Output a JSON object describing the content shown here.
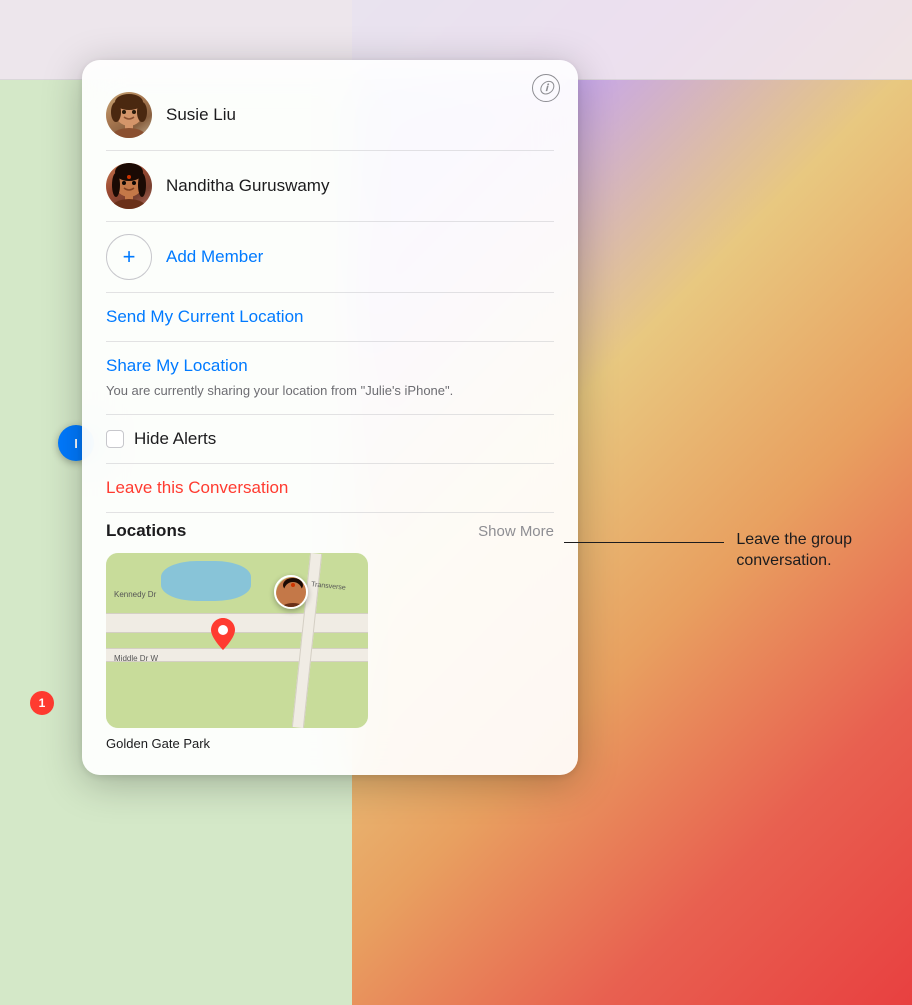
{
  "background": {
    "map_color": "#d4e8c8",
    "gradient_color_start": "#a8c8e8",
    "gradient_color_end": "#e84040"
  },
  "panel": {
    "info_icon": "ⓘ",
    "members": [
      {
        "name": "Susie Liu",
        "avatar_emoji": "👩",
        "avatar_type": "susie"
      },
      {
        "name": "Nanditha Guruswamy",
        "avatar_emoji": "👩",
        "avatar_type": "nanditha"
      }
    ],
    "add_member_label": "Add Member",
    "add_member_icon": "+",
    "actions": {
      "send_location": "Send My Current Location",
      "share_location": "Share My Location",
      "sharing_description": "You are currently sharing your location from \"Julie's iPhone\".",
      "hide_alerts": "Hide Alerts",
      "leave_conversation": "Leave this Conversation"
    },
    "locations": {
      "title": "Locations",
      "show_more": "Show More",
      "map_caption": "Golden Gate Park"
    }
  },
  "callout": {
    "text_line1": "Leave the group",
    "text_line2": "conversation."
  },
  "map_location_btn": "I",
  "map_badge": "1"
}
